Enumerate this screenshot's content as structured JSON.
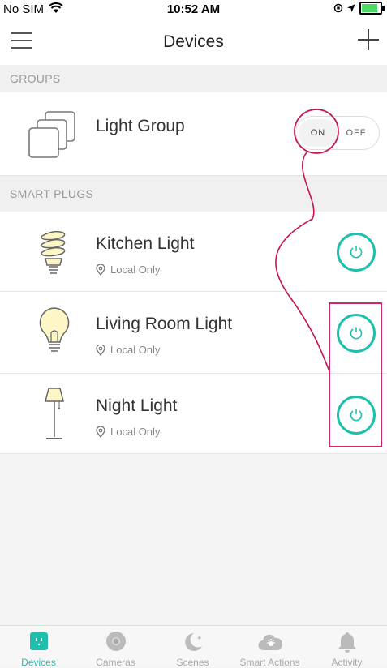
{
  "status": {
    "carrier": "No SIM",
    "time": "10:52 AM"
  },
  "nav": {
    "title": "Devices"
  },
  "sections": {
    "groups": "GROUPS",
    "plugs": "SMART PLUGS"
  },
  "group": {
    "name": "Light Group",
    "on_label": "ON",
    "off_label": "OFF"
  },
  "devices": [
    {
      "name": "Kitchen Light",
      "location": "Local Only"
    },
    {
      "name": "Living Room Light",
      "location": "Local Only"
    },
    {
      "name": "Night Light",
      "location": "Local Only"
    }
  ],
  "tabs": [
    {
      "label": "Devices",
      "icon": "plug-icon",
      "active": true
    },
    {
      "label": "Cameras",
      "icon": "camera-icon"
    },
    {
      "label": "Scenes",
      "icon": "moon-icon"
    },
    {
      "label": "Smart Actions",
      "icon": "cloud-icon"
    },
    {
      "label": "Activity",
      "icon": "bell-icon"
    }
  ],
  "colors": {
    "accent": "#1fbfad",
    "annotation": "#c4154d"
  }
}
